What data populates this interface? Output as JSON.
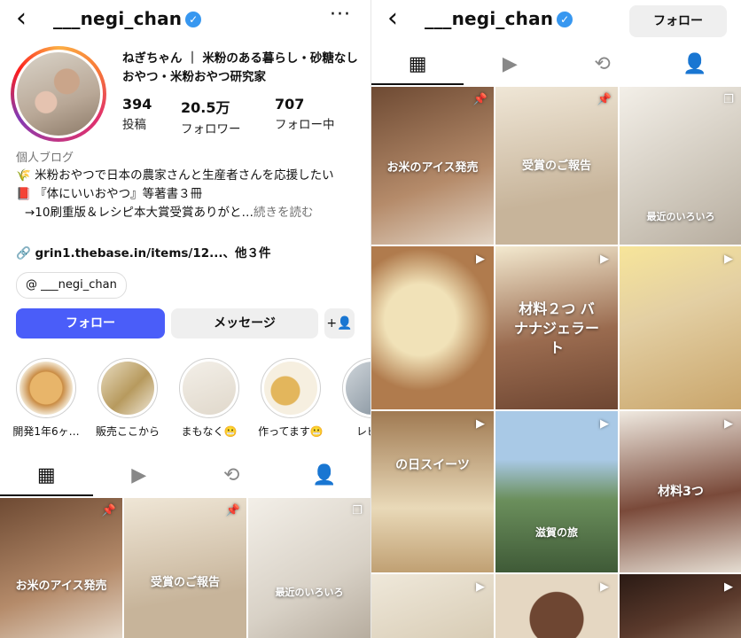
{
  "profile": {
    "username": "___negi_chan",
    "bio_name": "ねぎちゃん ｜ 米粉のある暮らし・砂糖なしおやつ・米粉おやつ研究家",
    "stats": [
      {
        "value": "394",
        "label": "投稿"
      },
      {
        "value": "20.5万",
        "label": "フォロワー"
      },
      {
        "value": "707",
        "label": "フォロー中"
      }
    ],
    "category": "個人ブログ",
    "bio_line1": "🌾 米粉おやつで日本の農家さんと生産者さんを応援したい",
    "bio_line2": "📕 『体にいいおやつ』等著書３冊",
    "bio_line3": "→10刷重版＆レシピ本大賞受賞ありがと…",
    "bio_more": "続きを読む",
    "link": "grin1.thebase.in/items/12...",
    "link_more": "、他３件",
    "threads": "___negi_chan"
  },
  "buttons": {
    "follow": "フォロー",
    "message": "メッセージ",
    "add_user": "+👤"
  },
  "highlights": [
    {
      "label": "開発1年6ヶ…",
      "color": "#d9a460"
    },
    {
      "label": "販売ここから",
      "color": "#c9b27a"
    },
    {
      "label": "まもなく😬",
      "color": "#e8e2d8"
    },
    {
      "label": "作ってます😬",
      "color": "#e3b65c"
    },
    {
      "label": "レビュ",
      "color": "#7c8a96"
    }
  ],
  "icons": {
    "back": "‹",
    "more": "···",
    "verified": "✓",
    "link": "🔗",
    "threads": "@",
    "grid": "▦",
    "reels": "▶",
    "reposts": "⟲",
    "tagged": "👤",
    "pin": "📌",
    "carousel": "❐",
    "video": "▶"
  },
  "posts_left": [
    {
      "caption": "お米のアイス発売",
      "color": "#8a5a3c",
      "badge": "pin"
    },
    {
      "caption": "受賞のご報告",
      "color": "#c7b49a",
      "badge": "pin"
    },
    {
      "caption": "最近のいろいろ",
      "color": "#d8d1c6",
      "badge": "carousel"
    }
  ],
  "posts_right": [
    {
      "caption": "お米のアイス発売",
      "color": "#8a5a3c",
      "badge": "pin"
    },
    {
      "caption": "受賞のご報告",
      "color": "#c7b49a",
      "badge": "pin"
    },
    {
      "caption": "最近のいろいろ",
      "color": "#cfc8bc",
      "badge": "carousel"
    },
    {
      "caption": "",
      "color": "#d9c9a0",
      "badge": "video"
    },
    {
      "caption": "材料２つ バナナジェラート",
      "color": "#9a6b4f",
      "badge": "video"
    },
    {
      "caption": "",
      "color": "#e3cfa3",
      "badge": "video"
    },
    {
      "caption": "の日スイーツ",
      "color": "#c0a073",
      "badge": "video"
    },
    {
      "caption": "滋賀の旅",
      "color": "#6b8f5c",
      "badge": "video"
    },
    {
      "caption": "材料3つ",
      "color": "#7a4a3a",
      "badge": "video"
    },
    {
      "caption": "",
      "color": "#e0d8ca",
      "badge": "video"
    },
    {
      "caption": "",
      "color": "#6e4632",
      "badge": "video"
    },
    {
      "caption": "",
      "color": "#3e2a22",
      "badge": "video"
    }
  ]
}
